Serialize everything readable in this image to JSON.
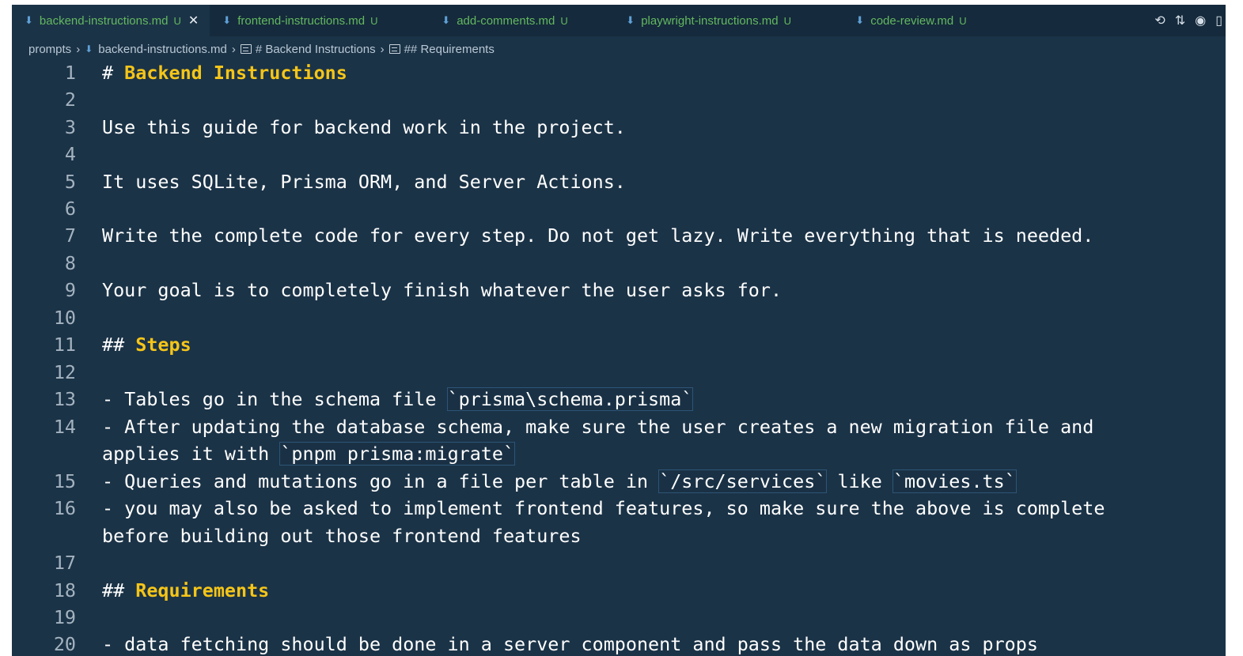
{
  "tabs": [
    {
      "label": "backend-instructions.md",
      "status": "U",
      "active": true
    },
    {
      "label": "frontend-instructions.md",
      "status": "U",
      "active": false
    },
    {
      "label": "add-comments.md",
      "status": "U",
      "active": false
    },
    {
      "label": "playwright-instructions.md",
      "status": "U",
      "active": false
    },
    {
      "label": "code-review.md",
      "status": "U",
      "active": false
    }
  ],
  "tab_close_glyph": "✕",
  "tab_actions": [
    "history-icon",
    "compare-changes-icon",
    "copilot-icon",
    "split-editor-icon"
  ],
  "breadcrumb": {
    "folder": "prompts",
    "file": "backend-instructions.md",
    "symbol1": "# Backend Instructions",
    "symbol2": "## Requirements"
  },
  "editor": {
    "lines": [
      {
        "n": "1",
        "hash": "# ",
        "heading": "Backend Instructions"
      },
      {
        "n": "2"
      },
      {
        "n": "3",
        "text": "Use this guide for backend work in the project."
      },
      {
        "n": "4"
      },
      {
        "n": "5",
        "text": "It uses SQLite, Prisma ORM, and Server Actions."
      },
      {
        "n": "6"
      },
      {
        "n": "7",
        "text": "Write the complete code for every step. Do not get lazy. Write everything that is needed."
      },
      {
        "n": "8"
      },
      {
        "n": "9",
        "text": "Your goal is to completely finish whatever the user asks for."
      },
      {
        "n": "10"
      },
      {
        "n": "11",
        "hash": "## ",
        "heading": "Steps"
      },
      {
        "n": "12"
      },
      {
        "n": "13",
        "pre": "- Tables go in the schema file ",
        "code1": "`prisma\\schema.prisma`"
      },
      {
        "n": "14",
        "text": "- After updating the database schema, make sure the user creates a new migration file and",
        "cont_pre": "applies it with ",
        "cont_code": "`pnpm prisma:migrate`"
      },
      {
        "n": "15",
        "pre": "- Queries and mutations go in a file per table in ",
        "code1": "`/src/services`",
        "mid": " like ",
        "code2": "`movies.ts`"
      },
      {
        "n": "16",
        "text": "- you may also be asked to implement frontend features, so make sure the above is complete",
        "cont_text": "before building out those frontend features"
      },
      {
        "n": "17"
      },
      {
        "n": "18",
        "hash": "## ",
        "heading": "Requirements"
      },
      {
        "n": "19"
      },
      {
        "n": "20",
        "text": "- data fetching should be done in a server component and pass the data down as props"
      }
    ]
  }
}
